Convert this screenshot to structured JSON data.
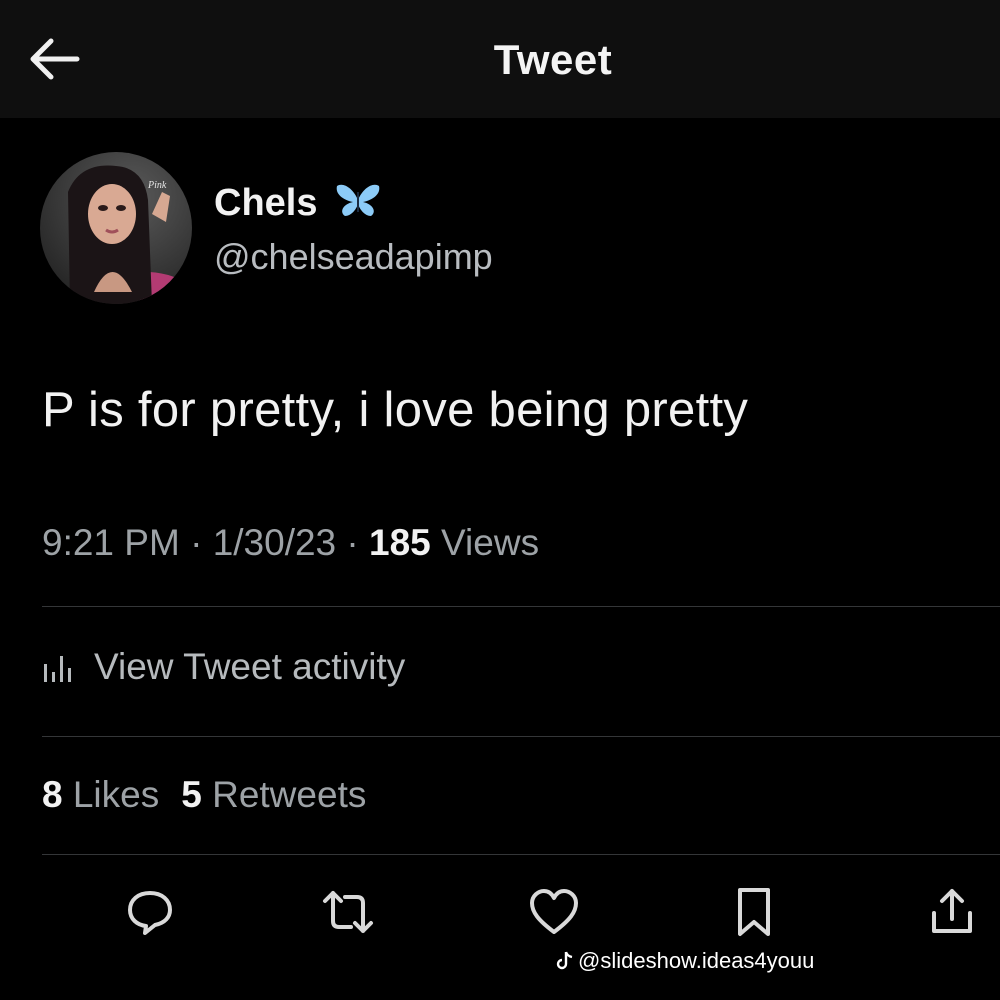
{
  "header": {
    "title": "Tweet",
    "back_icon": "arrow-left-icon"
  },
  "author": {
    "display_name": "Chels",
    "handle": "@chelseadapimp",
    "badge_icon": "butterfly-icon",
    "badge_color": "#7fc4f5"
  },
  "tweet": {
    "text": "P is for pretty, i love being pretty"
  },
  "meta": {
    "time": "9:21 PM",
    "date": "1/30/23",
    "separator": "·",
    "views_count": "185",
    "views_label": "Views"
  },
  "activity": {
    "label": "View Tweet activity",
    "icon": "bar-chart-icon"
  },
  "stats": {
    "likes_count": "8",
    "likes_label": "Likes",
    "retweets_count": "5",
    "retweets_label": "Retweets"
  },
  "actions": [
    {
      "icon": "reply-icon"
    },
    {
      "icon": "retweet-icon"
    },
    {
      "icon": "heart-icon"
    },
    {
      "icon": "bookmark-icon"
    },
    {
      "icon": "share-icon"
    }
  ],
  "watermark": {
    "text": "@slideshow.ideas4youu",
    "icon": "tiktok-icon"
  }
}
